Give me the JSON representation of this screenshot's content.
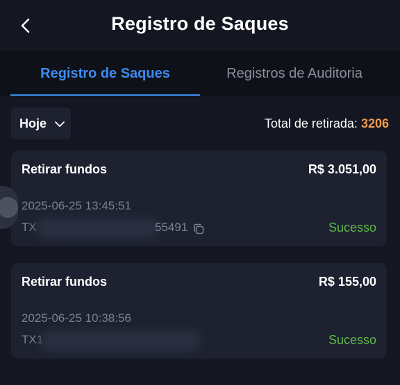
{
  "header": {
    "title": "Registro de Saques",
    "back_icon": "chevron-left-icon"
  },
  "tabs": [
    {
      "label": "Registro de Saques",
      "active": true
    },
    {
      "label": "Registros de Auditoria",
      "active": false
    }
  ],
  "filter": {
    "date_label": "Hoje",
    "dropdown_icon": "chevron-down-icon"
  },
  "summary": {
    "total_label": "Total de retirada:",
    "total_value": "3206"
  },
  "records": [
    {
      "type": "Retirar fundos",
      "amount": "R$ 3.051,00",
      "datetime": "2025-06-25 13:45:51",
      "tx_prefix": "TX",
      "tx_suffix": "55491",
      "status": "Sucesso"
    },
    {
      "type": "Retirar fundos",
      "amount": "R$ 155,00",
      "datetime": "2025-06-25 10:38:56",
      "tx_prefix": "TX1",
      "tx_suffix": "",
      "status": "Sucesso"
    }
  ],
  "colors": {
    "background": "#141621",
    "tab_bar": "#0f1119",
    "card": "#1d2130",
    "accent_blue": "#3d8bf0",
    "total_orange": "#f09a4c",
    "status_green": "#5fba46",
    "muted_text": "#7c8190"
  }
}
